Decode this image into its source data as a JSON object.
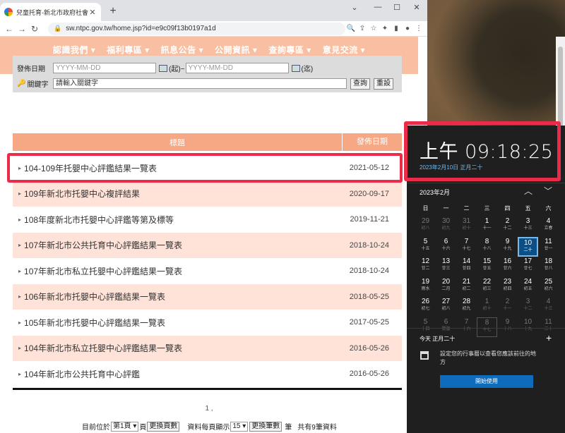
{
  "browser": {
    "tab_title": "兒童托育-新北市政府社會局",
    "url": "sw.ntpc.gov.tw/home.jsp?id=e9c09f13b0197a1d"
  },
  "nav_menu": [
    "認識我們 ▾",
    "福利專區 ▾",
    "訊息公告 ▾",
    "公開資訊 ▾",
    "查詢專區 ▾",
    "意見交流 ▾"
  ],
  "search": {
    "date_label": "發佈日期",
    "date_placeholder": "YYYY-MM-DD",
    "from_label": "(起)~",
    "to_label": "(迄)",
    "keyword_label": "關鍵字",
    "keyword_value": "請輸入關鍵字",
    "search_button": "查詢",
    "reset_button": "重設"
  },
  "table": {
    "col_title": "標題",
    "col_date": "發佈日期",
    "rows": [
      {
        "title": "104-109年托嬰中心評鑑結果一覽表",
        "date": "2021-05-12"
      },
      {
        "title": "109年新北市托嬰中心複評結果",
        "date": "2020-09-17"
      },
      {
        "title": "108年度新北市托嬰中心評鑑等第及標等",
        "date": "2019-11-21"
      },
      {
        "title": "107年新北市公共托育中心評鑑結果一覽表",
        "date": "2018-10-24"
      },
      {
        "title": "107年新北市私立托嬰中心評鑑結果一覽表",
        "date": "2018-10-24"
      },
      {
        "title": "106年新北市托嬰中心評鑑結果一覽表",
        "date": "2018-05-25"
      },
      {
        "title": "105年新北市托嬰中心評鑑結果一覽表",
        "date": "2017-05-25"
      },
      {
        "title": "104年新北市私立托嬰中心評鑑結果一覽表",
        "date": "2016-05-26"
      },
      {
        "title": "104年新北市公共托育中心評鑑",
        "date": "2016-05-26"
      }
    ]
  },
  "pagination": {
    "page_numbers": "1 ,",
    "current_label": "目前位於",
    "page_select": "第1頁 ▾",
    "page_suffix": "頁",
    "change_page_button": "更換頁數",
    "per_page_label": "資料每頁顯示",
    "per_page_select": "15 ▾",
    "change_count_button": "更換筆數",
    "count_suffix": "筆",
    "total": "共有9筆資料"
  },
  "clock": {
    "time": "上午 09:18:25",
    "date": "2023年2月10日 正月二十",
    "month": "2023年2月",
    "weekdays": [
      "日",
      "一",
      "二",
      "三",
      "四",
      "五",
      "六"
    ],
    "weeks": [
      [
        {
          "d": "29",
          "l": "初八",
          "dim": true
        },
        {
          "d": "30",
          "l": "初九",
          "dim": true
        },
        {
          "d": "31",
          "l": "初十",
          "dim": true
        },
        {
          "d": "1",
          "l": "十一"
        },
        {
          "d": "2",
          "l": "十二"
        },
        {
          "d": "3",
          "l": "十三"
        },
        {
          "d": "4",
          "l": "立春"
        }
      ],
      [
        {
          "d": "5",
          "l": "十五"
        },
        {
          "d": "6",
          "l": "十六"
        },
        {
          "d": "7",
          "l": "十七"
        },
        {
          "d": "8",
          "l": "十八"
        },
        {
          "d": "9",
          "l": "十九"
        },
        {
          "d": "10",
          "l": "二十",
          "today": true
        },
        {
          "d": "11",
          "l": "廿一"
        }
      ],
      [
        {
          "d": "12",
          "l": "廿二"
        },
        {
          "d": "13",
          "l": "廿三"
        },
        {
          "d": "14",
          "l": "廿四"
        },
        {
          "d": "15",
          "l": "廿五"
        },
        {
          "d": "16",
          "l": "廿六"
        },
        {
          "d": "17",
          "l": "廿七"
        },
        {
          "d": "18",
          "l": "廿八"
        }
      ],
      [
        {
          "d": "19",
          "l": "雨水"
        },
        {
          "d": "20",
          "l": "二月"
        },
        {
          "d": "21",
          "l": "初二"
        },
        {
          "d": "22",
          "l": "初三"
        },
        {
          "d": "23",
          "l": "初四"
        },
        {
          "d": "24",
          "l": "初五"
        },
        {
          "d": "25",
          "l": "初六"
        }
      ],
      [
        {
          "d": "26",
          "l": "初七"
        },
        {
          "d": "27",
          "l": "初八"
        },
        {
          "d": "28",
          "l": "初九"
        },
        {
          "d": "1",
          "l": "初十",
          "dim": true
        },
        {
          "d": "2",
          "l": "十一",
          "dim": true
        },
        {
          "d": "3",
          "l": "十二",
          "dim": true
        },
        {
          "d": "4",
          "l": "十三",
          "dim": true
        }
      ],
      [
        {
          "d": "5",
          "l": "十四",
          "dim": true
        },
        {
          "d": "6",
          "l": "驚蟄",
          "dim": true
        },
        {
          "d": "7",
          "l": "十六",
          "dim": true
        },
        {
          "d": "8",
          "l": "十七",
          "dim": true,
          "boxed": true
        },
        {
          "d": "9",
          "l": "十八",
          "dim": true
        },
        {
          "d": "10",
          "l": "十九",
          "dim": true
        },
        {
          "d": "11",
          "l": "二十",
          "dim": true
        }
      ]
    ],
    "agenda_title": "今天 正月二十",
    "agenda_text": "設定您的行事曆以查看您應該前往的地方",
    "start_button": "開始使用"
  }
}
